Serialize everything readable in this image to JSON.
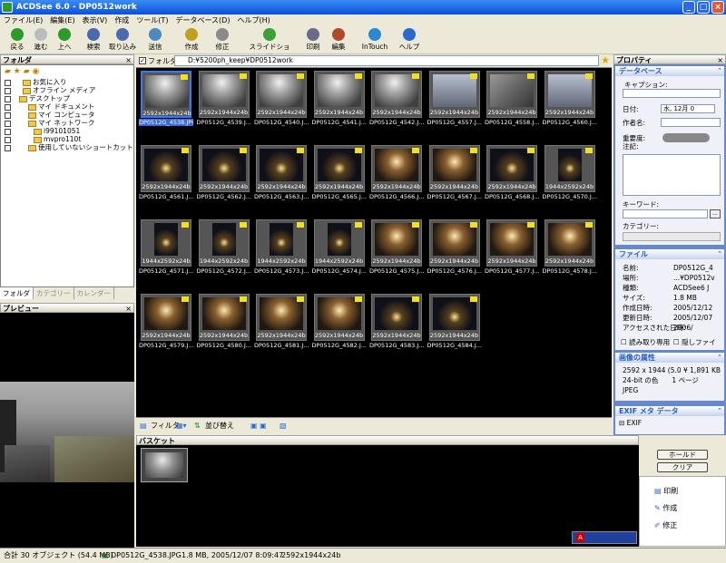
{
  "window": {
    "title": "ACDSee 6.0 - DP0512work"
  },
  "menu": [
    "ファイル(E)",
    "編集(E)",
    "表示(V)",
    "作成",
    "ツール(T)",
    "データベース(D)",
    "ヘルプ(H)"
  ],
  "toolbar": [
    {
      "label": "戻る",
      "color": "#2a9a2a"
    },
    {
      "label": "進む",
      "color": "#bbbbbb"
    },
    {
      "label": "上へ",
      "color": "#2a9a2a"
    },
    {
      "label": "検索",
      "color": "#4a6ab0"
    },
    {
      "label": "取り込み",
      "color": "#4a6ab0"
    },
    {
      "label": "送信",
      "color": "#4a8ac0"
    },
    {
      "label": "作成",
      "color": "#c0a020"
    },
    {
      "label": "修正",
      "color": "#8a8a8a"
    },
    {
      "label": "スライドショー",
      "color": "#3aa03a"
    },
    {
      "label": "印刷",
      "color": "#6a6a8a"
    },
    {
      "label": "編集",
      "color": "#b04a2a"
    },
    {
      "label": "InTouch",
      "color": "#2a8ad0"
    },
    {
      "label": "ヘルプ",
      "color": "#2a6ad0"
    }
  ],
  "folder_panel": {
    "title": "フォルダ",
    "items": [
      "お気に入り",
      "オフライン メディア",
      "デスクトップ",
      "マイ ドキュメント",
      "マイ コンピュータ",
      "マイ ネットワーク",
      "i99101051",
      "mvpro110t",
      "使用していないショートカット"
    ],
    "tabs": [
      "フォルダ",
      "カテゴリー",
      "カレンダー"
    ]
  },
  "preview_panel": {
    "title": "プレビュー"
  },
  "address": {
    "label": "フォルダ:",
    "path": "D:¥5200ph_keep¥DP0512work"
  },
  "thumbnails": [
    {
      "name": "DP0512G_4538.JPG",
      "res": "2592x1944x24b",
      "tone": "fog"
    },
    {
      "name": "DP0512G_4539.J...",
      "res": "2592x1944x24b",
      "tone": "fog"
    },
    {
      "name": "DP0512G_4540.J...",
      "res": "2592x1944x24b",
      "tone": "fog"
    },
    {
      "name": "DP0512G_4541.J...",
      "res": "2592x1944x24b",
      "tone": "fog"
    },
    {
      "name": "DP0512G_4542.J...",
      "res": "2592x1944x24b",
      "tone": "fog"
    },
    {
      "name": "DP0512G_4557.J...",
      "res": "2592x1944x24b",
      "tone": "bright"
    },
    {
      "name": "DP0512G_4558.J...",
      "res": "2592x1944x24b",
      "tone": "grey"
    },
    {
      "name": "DP0512G_4560.J...",
      "res": "2592x1944x24b",
      "tone": "bright"
    },
    {
      "name": "DP0512G_4561.J...",
      "res": "2592x1944x24b",
      "tone": "night"
    },
    {
      "name": "DP0512G_4562.J...",
      "res": "2592x1944x24b",
      "tone": "night"
    },
    {
      "name": "DP0512G_4563.J...",
      "res": "2592x1944x24b",
      "tone": "night"
    },
    {
      "name": "DP0512G_4565.J...",
      "res": "2592x1944x24b",
      "tone": "night"
    },
    {
      "name": "DP0512G_4566.J...",
      "res": "2592x1944x24b",
      "tone": "warm"
    },
    {
      "name": "DP0512G_4567.J...",
      "res": "2592x1944x24b",
      "tone": "warm"
    },
    {
      "name": "DP0512G_4568.J...",
      "res": "2592x1944x24b",
      "tone": "night"
    },
    {
      "name": "DP0512G_4570.J...",
      "res": "1944x2592x24b",
      "tone": "night"
    },
    {
      "name": "DP0512G_4571.J...",
      "res": "1944x2592x24b",
      "tone": "night"
    },
    {
      "name": "DP0512G_4572.J...",
      "res": "1944x2592x24b",
      "tone": "night"
    },
    {
      "name": "DP0512G_4573.J...",
      "res": "1944x2592x24b",
      "tone": "night"
    },
    {
      "name": "DP0512G_4574.J...",
      "res": "1944x2592x24b",
      "tone": "night"
    },
    {
      "name": "DP0512G_4575.J...",
      "res": "2592x1944x24b",
      "tone": "warm"
    },
    {
      "name": "DP0512G_4576.J...",
      "res": "2592x1944x24b",
      "tone": "warm"
    },
    {
      "name": "DP0512G_4577.J...",
      "res": "2592x1944x24b",
      "tone": "warm"
    },
    {
      "name": "DP0512G_4578.J...",
      "res": "2592x1944x24b",
      "tone": "warm"
    },
    {
      "name": "DP0512G_4579.J...",
      "res": "2592x1944x24b",
      "tone": "warm"
    },
    {
      "name": "DP0512G_4580.J...",
      "res": "2592x1944x24b",
      "tone": "warm"
    },
    {
      "name": "DP0512G_4581.J...",
      "res": "2592x1944x24b",
      "tone": "warm"
    },
    {
      "name": "DP0512G_4582.J...",
      "res": "2592x1944x24b",
      "tone": "warm"
    },
    {
      "name": "DP0512G_4583.J...",
      "res": "2592x1944x24b",
      "tone": "night"
    },
    {
      "name": "DP0512G_4584.J...",
      "res": "2592x1944x24b",
      "tone": "night"
    }
  ],
  "thumb_toolbar": {
    "filter": "フィルタ",
    "sort": "並び替え"
  },
  "basket": {
    "title": "バスケット",
    "hold": "ホールド",
    "clear": "クリア",
    "actions": [
      "印刷",
      "作成",
      "修正"
    ]
  },
  "properties": {
    "title": "プロパティ",
    "database": {
      "title": "データベース",
      "caption": "キャプション:",
      "date_label": "日付:",
      "date_value": "水, 12月 0",
      "author": "作者名:",
      "rating": "重要度:",
      "notes": "注記:",
      "keyword": "キーワード:",
      "category": "カテゴリー:"
    },
    "file": {
      "title": "ファイル",
      "rows": [
        {
          "k": "名前:",
          "v": "DP0512G_4"
        },
        {
          "k": "場所:",
          "v": "...¥DP0512v"
        },
        {
          "k": "種類:",
          "v": "ACDSee6 J"
        },
        {
          "k": "サイズ:",
          "v": "1.8 MB"
        },
        {
          "k": "作成日時:",
          "v": "2005/12/12"
        },
        {
          "k": "更新日時:",
          "v": "2005/12/07"
        },
        {
          "k": "アクセスされた日時:",
          "v": "2006/"
        }
      ],
      "readonly": "読み取り専用",
      "hidden": "隠しファイ"
    },
    "image": {
      "title": "画像の属性",
      "lines": [
        "2592 x 1944 (5.0 ¥ 1,891 KB",
        "24-bit の色　　1 ページ",
        "JPEG"
      ]
    },
    "exif": {
      "title": "EXIF メタ データ",
      "root": "EXIF"
    }
  },
  "status": {
    "total": "合計 30 オブジェクト (54.4 MB)",
    "file": "DP0512G_4538.JPG",
    "info": "1.8 MB, 2005/12/07 8:09:47",
    "dims": "2592x1944x24b"
  }
}
